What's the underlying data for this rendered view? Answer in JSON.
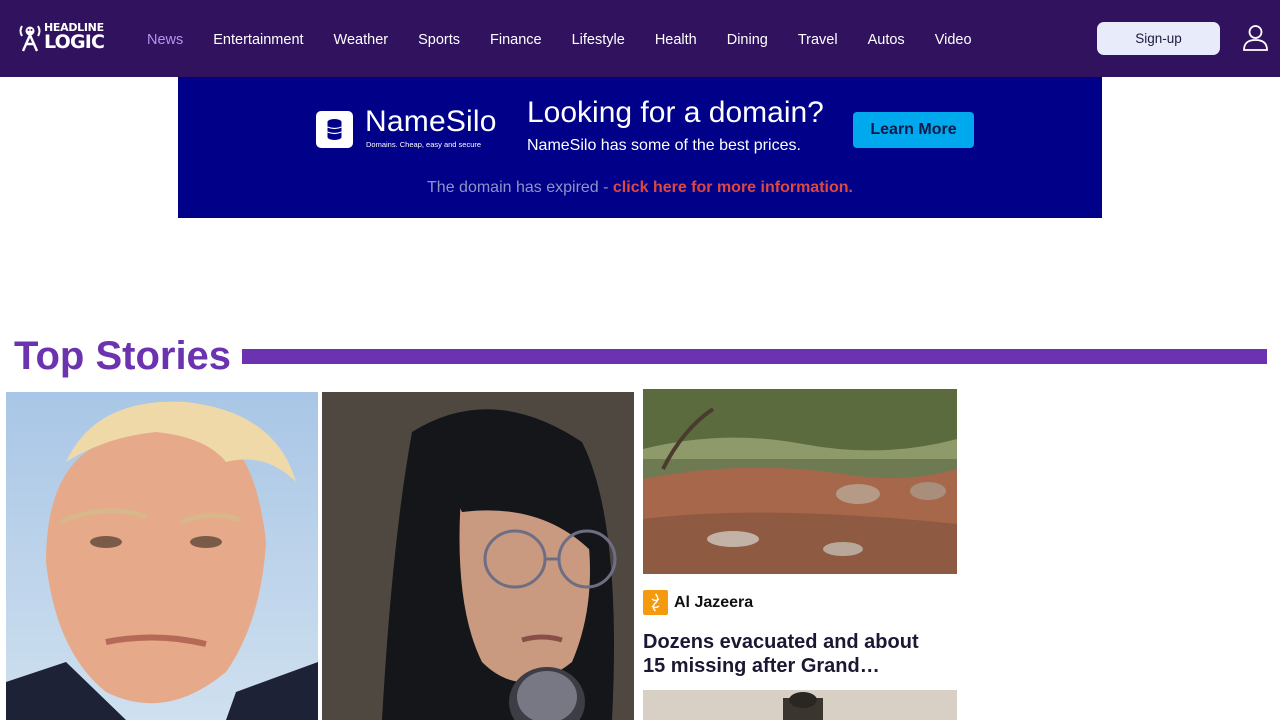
{
  "header": {
    "logo": {
      "line1": "HEADLINE",
      "line2": "LOGIC"
    },
    "nav": [
      "News",
      "Entertainment",
      "Weather",
      "Sports",
      "Finance",
      "Lifestyle",
      "Health",
      "Dining",
      "Travel",
      "Autos",
      "Video"
    ],
    "active_nav": "News",
    "signup_label": "Sign-up",
    "colors": {
      "background": "#31125e",
      "active": "#b295f0"
    }
  },
  "ad": {
    "brand": "NameSilo",
    "tagline": "Domains. Cheap, easy and secure",
    "headline": "Looking for a domain?",
    "subline": "NameSilo has some of the best prices.",
    "button": "Learn More",
    "footer_text": "The domain has expired - ",
    "footer_link": "click here for more information.",
    "colors": {
      "background": "#000088",
      "button": "#00a9ed",
      "link": "#e0473f"
    }
  },
  "top_stories": {
    "title": "Top Stories",
    "accent": "#6b33b0",
    "story": {
      "source": "Al Jazeera",
      "headline": "Dozens evacuated and about 15 missing after Grand…"
    }
  }
}
